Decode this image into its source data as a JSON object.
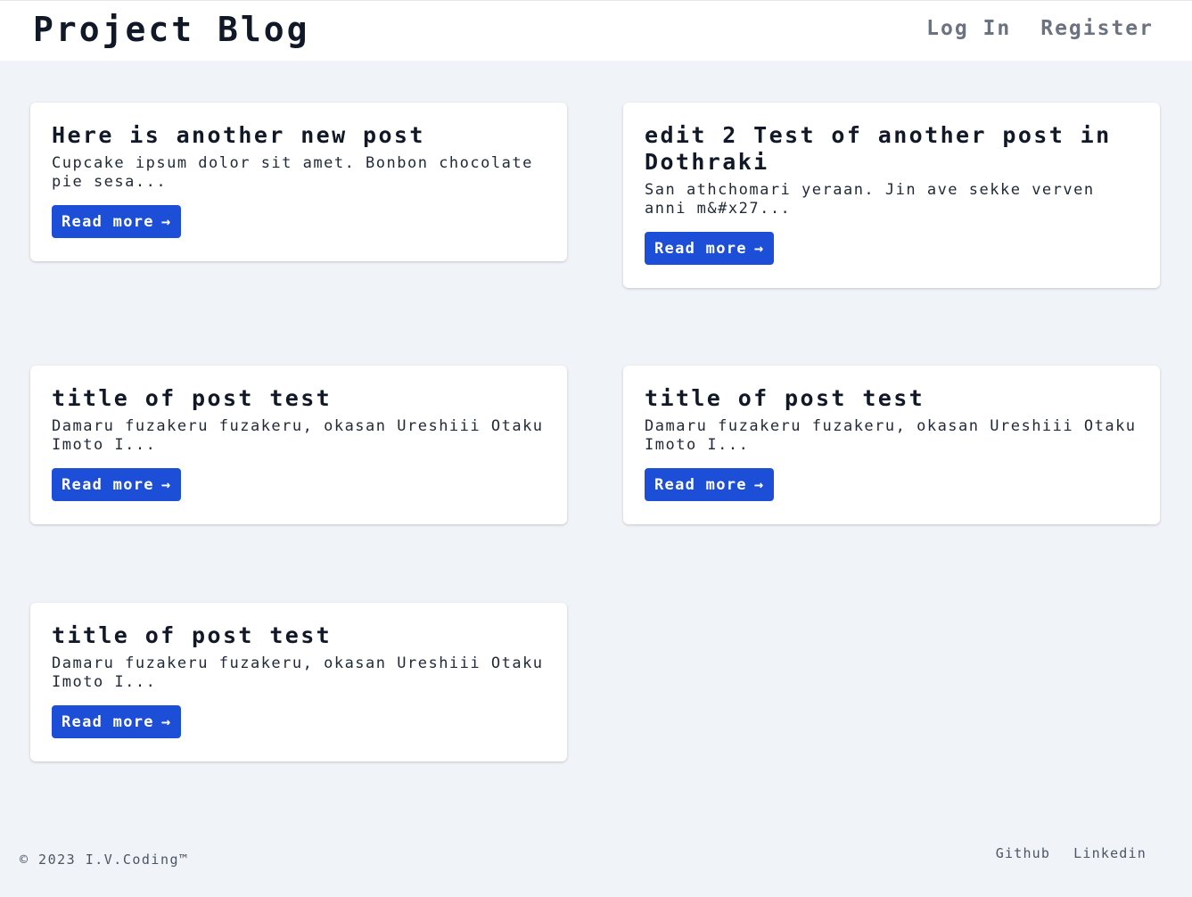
{
  "header": {
    "title": "Project Blog",
    "nav": [
      {
        "label": "Log In"
      },
      {
        "label": "Register"
      }
    ]
  },
  "posts": [
    {
      "title": "Here is another new post",
      "excerpt": "Cupcake ipsum dolor sit amet. Bonbon chocolate pie sesa...",
      "read_more": "Read more"
    },
    {
      "title": "edit 2 Test of another post in Dothraki",
      "excerpt": "San athchomari yeraan. Jin ave sekke verven anni m&#x27...",
      "read_more": "Read more"
    },
    {
      "title": "title of post test",
      "excerpt": "Damaru fuzakeru fuzakeru, okasan Ureshiii Otaku Imoto I...",
      "read_more": "Read more"
    },
    {
      "title": "title of post test",
      "excerpt": "Damaru fuzakeru fuzakeru, okasan Ureshiii Otaku Imoto I...",
      "read_more": "Read more"
    },
    {
      "title": "title of post test",
      "excerpt": "Damaru fuzakeru fuzakeru, okasan Ureshiii Otaku Imoto I...",
      "read_more": "Read more"
    }
  ],
  "icons": {
    "arrow": "arrow-right-icon"
  },
  "footer": {
    "copyright": "© 2023 I.V.Coding™",
    "links": [
      {
        "label": "Github"
      },
      {
        "label": "Linkedin"
      }
    ]
  },
  "colors": {
    "page_background": "#f0f3f8",
    "button_primary": "#1d4ed8",
    "nav_text": "#6b7280"
  }
}
